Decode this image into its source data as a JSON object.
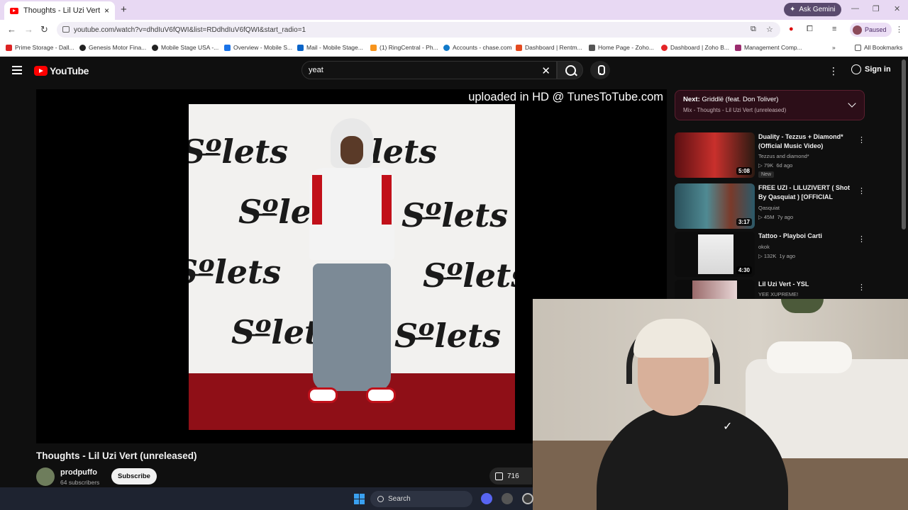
{
  "browser": {
    "tab_title": "Thoughts - Lil Uzi Vert (unrelea",
    "tab_close": "×",
    "new_tab": "+",
    "gemini_label": "Ask Gemini",
    "url": "youtube.com/watch?v=dhdIuV6fQWI&list=RDdhdIuV6fQWI&start_radio=1",
    "profile_status": "Paused",
    "bookmarks": [
      "Prime Storage - Dall...",
      "Genesis Motor Fina...",
      "Mobile Stage USA -...",
      "Overview - Mobile S...",
      "Mail - Mobile Stage...",
      "(1) RingCentral - Ph...",
      "Accounts - chase.com",
      "Dashboard | Rentm...",
      "Home Page - Zoho...",
      "Dashboard | Zoho B...",
      "Management Comp..."
    ],
    "all_bookmarks": "All Bookmarks"
  },
  "youtube": {
    "logo_text": "YouTube",
    "search_value": "yeat",
    "signin_label": "Sign in",
    "watermark": "uploaded in HD @ TunesToTube.com",
    "video_title": "Thoughts - Lil Uzi Vert (unreleased)",
    "channel_name": "prodpuffo",
    "channel_subs": "64 subscribers",
    "subscribe_label": "Subscribe",
    "like_count": "716",
    "next": {
      "label": "Next:",
      "title": "Griddlë (feat. Don Toliver)",
      "mix": "Mix - Thoughts - Lil Uzi Vert (unreleased)"
    },
    "recommendations": [
      {
        "title": "Duality - Tezzus + Diamond* (Official Music Video)",
        "channel": "Tezzus and diamond*",
        "views": "▷ 79K",
        "age": "6d ago",
        "badge": "New",
        "duration": "5:08",
        "color": "#8a1a1a"
      },
      {
        "title": "FREE UZI  - LILUZIVERT ( Shot By Qasquiat ) [OFFICIAL MUSI...",
        "channel": "Qasquiat",
        "views": "▷ 45M",
        "age": "7y ago",
        "duration": "3:17",
        "color": "#3f6f78"
      },
      {
        "title": "Tattoo - Playboi Carti",
        "channel": "okok",
        "views": "▷ 132K",
        "age": "1y ago",
        "duration": "4:30",
        "color": "#101010"
      },
      {
        "title": "Lil Uzi Vert - YSL",
        "channel": "YEE XUPREME!",
        "color": "#c8a8a8"
      }
    ]
  },
  "taskbar": {
    "search_label": "Search"
  }
}
